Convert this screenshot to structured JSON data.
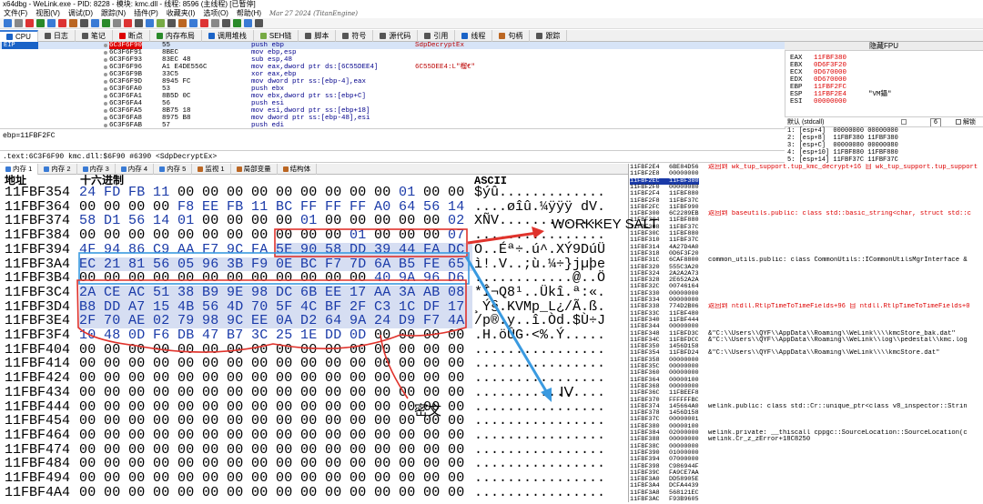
{
  "window_title": "x64dbg - WeLink.exe - PID: 8228 - 模块: kmc.dll - 线程: 8596 (主线程) [已暂停]",
  "menu": [
    "文件(F)",
    "视图(V)",
    "调试(D)",
    "跟踪(N)",
    "插件(P)",
    "收藏夹(I)",
    "选项(O)",
    "帮助(H)"
  ],
  "build_date": "Mar 27 2024 (TitanEngine)",
  "tabs": [
    {
      "label": "CPU",
      "color": "#1a63c7"
    },
    {
      "label": "日志",
      "color": "#555"
    },
    {
      "label": "笔记",
      "color": "#555"
    },
    {
      "label": "断点",
      "color": "#d00"
    },
    {
      "label": "内存布局",
      "color": "#2a8a2a"
    },
    {
      "label": "调用堆栈",
      "color": "#1a63c7"
    },
    {
      "label": "SEH链",
      "color": "#7a4"
    },
    {
      "label": "脚本",
      "color": "#555"
    },
    {
      "label": "符号",
      "color": "#555"
    },
    {
      "label": "源代码",
      "color": "#555"
    },
    {
      "label": "引用",
      "color": "#555"
    },
    {
      "label": "线程",
      "color": "#1a63c7"
    },
    {
      "label": "句柄",
      "color": "#b62"
    },
    {
      "label": "跟踪",
      "color": "#555"
    }
  ],
  "eip_label": "EIP",
  "cpu_rows": [
    {
      "addr": "6C3F6F90",
      "bytes": "55",
      "instr": "push ebp",
      "comment": "SdpDecryptEx"
    },
    {
      "addr": "6C3F6F91",
      "bytes": "8BEC",
      "instr": "mov ebp,esp",
      "comment": ""
    },
    {
      "addr": "6C3F6F93",
      "bytes": "83EC 48",
      "instr": "sub esp,48",
      "comment": ""
    },
    {
      "addr": "6C3F6F96",
      "bytes": "A1 E4DE556C",
      "instr": "mov eax,dword ptr ds:[6C55DEE4]",
      "comment": "6C55DEE4:L\"榴€\""
    },
    {
      "addr": "6C3F6F9B",
      "bytes": "33C5",
      "instr": "xor eax,ebp",
      "comment": ""
    },
    {
      "addr": "6C3F6F9D",
      "bytes": "8945 FC",
      "instr": "mov dword ptr ss:[ebp-4],eax",
      "comment": ""
    },
    {
      "addr": "6C3F6FA0",
      "bytes": "53",
      "instr": "push ebx",
      "comment": ""
    },
    {
      "addr": "6C3F6FA1",
      "bytes": "8B5D 0C",
      "instr": "mov ebx,dword ptr ss:[ebp+C]",
      "comment": ""
    },
    {
      "addr": "6C3F6FA4",
      "bytes": "56",
      "instr": "push esi",
      "comment": ""
    },
    {
      "addr": "6C3F6FA5",
      "bytes": "8B75 18",
      "instr": "mov esi,dword ptr ss:[ebp+18]",
      "comment": ""
    },
    {
      "addr": "6C3F6FA8",
      "bytes": "8975 B8",
      "instr": "mov dword ptr ss:[ebp-48],esi",
      "comment": ""
    },
    {
      "addr": "6C3F6FAB",
      "bytes": "57",
      "instr": "push edi",
      "comment": ""
    }
  ],
  "reg_header": "隐藏FPU",
  "registers": [
    {
      "name": "EAX",
      "value": "11FBF380",
      "note": ""
    },
    {
      "name": "EBX",
      "value": "0D6F3F20",
      "note": ""
    },
    {
      "name": "ECX",
      "value": "0D670000",
      "note": ""
    },
    {
      "name": "EDX",
      "value": "0D670000",
      "note": ""
    },
    {
      "name": "EBP",
      "value": "11FBF2FC",
      "note": ""
    },
    {
      "name": "ESP",
      "value": "11FBF2E4",
      "note": "\"VM鑷\""
    },
    {
      "name": "ESI",
      "value": "00000000",
      "note": ""
    }
  ],
  "callconv": "默认 (stdcall)",
  "callconv_count": "6",
  "unlock_label": "解锁",
  "stack_args": [
    "1: [esp+4]  00000000 00000000",
    "2: [esp+8]  11FBF380 11FBF380",
    "3: [esp+C]  00000080 00000080",
    "4: [esp+10] 11FBF880 11FBF880",
    "5: [esp+14] 11FBF37C 11FBF37C"
  ],
  "info_line": "ebp=11FBF2FC",
  "info_line2": ".text:6C3F6F90 kmc.dll:$6F90 #6390 <SdpDecryptEx>",
  "dump_tabs": [
    "内存 1",
    "内存 2",
    "内存 3",
    "内存 4",
    "内存 5",
    "监视 1",
    "局部变量",
    "结构体"
  ],
  "dump_headers": {
    "addr": "地址",
    "hex": "十六进制",
    "ascii": "ASCII"
  },
  "dump_rows": [
    {
      "addr": "11FBF354",
      "hex": [
        "24",
        "FD",
        "FB",
        "11",
        "00",
        "00",
        "00",
        "00",
        "00",
        "00",
        "00",
        "00",
        "00",
        "01",
        "00",
        "00"
      ],
      "ascii": "$ýû............."
    },
    {
      "addr": "11FBF364",
      "hex": [
        "00",
        "00",
        "00",
        "00",
        "F8",
        "EE",
        "FB",
        "11",
        "BC",
        "FF",
        "FF",
        "FF",
        "A0",
        "64",
        "56",
        "14"
      ],
      "ascii": "....øîû.¼ÿÿÿ dV."
    },
    {
      "addr": "11FBF374",
      "hex": [
        "58",
        "D1",
        "56",
        "14",
        "01",
        "00",
        "00",
        "00",
        "00",
        "01",
        "00",
        "00",
        "00",
        "00",
        "00",
        "02"
      ],
      "ascii": "XÑV............."
    },
    {
      "addr": "11FBF384",
      "hex": [
        "00",
        "00",
        "00",
        "00",
        "00",
        "00",
        "00",
        "00",
        "00",
        "00",
        "00",
        "01",
        "00",
        "00",
        "00",
        "07"
      ],
      "ascii": "................"
    },
    {
      "addr": "11FBF394",
      "hex": [
        "4F",
        "94",
        "86",
        "C9",
        "AA",
        "F7",
        "9C",
        "FA",
        "5E",
        "90",
        "58",
        "DD",
        "39",
        "44",
        "FA",
        "DC"
      ],
      "ascii": "O..Éª÷.ú^.XÝ9DúÜ"
    },
    {
      "addr": "11FBF3A4",
      "hex": [
        "EC",
        "21",
        "81",
        "56",
        "05",
        "96",
        "3B",
        "F9",
        "0E",
        "BC",
        "F7",
        "7D",
        "6A",
        "B5",
        "FE",
        "65"
      ],
      "ascii": "ì!.V..;ù.¼÷}jµþe"
    },
    {
      "addr": "11FBF3B4",
      "hex": [
        "00",
        "00",
        "00",
        "00",
        "00",
        "00",
        "00",
        "00",
        "00",
        "00",
        "00",
        "00",
        "40",
        "9A",
        "96",
        "D6"
      ],
      "ascii": "............@..Ö"
    },
    {
      "addr": "11FBF3C4",
      "hex": [
        "2A",
        "CE",
        "AC",
        "51",
        "38",
        "B9",
        "9E",
        "98",
        "DC",
        "6B",
        "EE",
        "17",
        "AA",
        "3A",
        "AB",
        "08"
      ],
      "ascii": "*Î¬Q8¹..Ükî.ª:«."
    },
    {
      "addr": "11FBF3D4",
      "hex": [
        "B8",
        "DD",
        "A7",
        "15",
        "4B",
        "56",
        "4D",
        "70",
        "5F",
        "4C",
        "BF",
        "2F",
        "C3",
        "1C",
        "DF",
        "17"
      ],
      "ascii": "¸Ý§.KVMp_L¿/Ã.ß."
    },
    {
      "addr": "11FBF3E4",
      "hex": [
        "2F",
        "70",
        "AE",
        "02",
        "79",
        "98",
        "9C",
        "EE",
        "0A",
        "D2",
        "64",
        "9A",
        "24",
        "D9",
        "F7",
        "4A"
      ],
      "ascii": "/p®.y..î.Òd.$Ù÷J"
    },
    {
      "addr": "11FBF3F4",
      "hex": [
        "10",
        "48",
        "0D",
        "F6",
        "DB",
        "47",
        "B7",
        "3C",
        "25",
        "1E",
        "DD",
        "0D",
        "00",
        "00",
        "00",
        "00"
      ],
      "ascii": ".H.öÛG·<%.Ý....."
    },
    {
      "addr": "11FBF404",
      "hex": [
        "00",
        "00",
        "00",
        "00",
        "00",
        "00",
        "00",
        "00",
        "00",
        "00",
        "00",
        "00",
        "00",
        "00",
        "00",
        "00"
      ],
      "ascii": "................"
    },
    {
      "addr": "11FBF414",
      "hex": [
        "00",
        "00",
        "00",
        "00",
        "00",
        "00",
        "00",
        "00",
        "00",
        "00",
        "00",
        "00",
        "00",
        "00",
        "00",
        "00"
      ],
      "ascii": "................"
    },
    {
      "addr": "11FBF424",
      "hex": [
        "00",
        "00",
        "00",
        "00",
        "00",
        "00",
        "00",
        "00",
        "00",
        "00",
        "00",
        "00",
        "00",
        "00",
        "00",
        "00"
      ],
      "ascii": "................"
    },
    {
      "addr": "11FBF434",
      "hex": [
        "00",
        "00",
        "00",
        "00",
        "00",
        "00",
        "00",
        "00",
        "00",
        "00",
        "00",
        "00",
        "00",
        "00",
        "00",
        "00"
      ],
      "ascii": "................"
    },
    {
      "addr": "11FBF444",
      "hex": [
        "00",
        "00",
        "00",
        "00",
        "00",
        "00",
        "00",
        "00",
        "00",
        "00",
        "00",
        "00",
        "00",
        "00",
        "00",
        "00"
      ],
      "ascii": "................"
    },
    {
      "addr": "11FBF454",
      "hex": [
        "00",
        "00",
        "00",
        "00",
        "00",
        "00",
        "00",
        "00",
        "00",
        "00",
        "00",
        "00",
        "00",
        "00",
        "00",
        "00"
      ],
      "ascii": "................"
    },
    {
      "addr": "11FBF464",
      "hex": [
        "00",
        "00",
        "00",
        "00",
        "00",
        "00",
        "00",
        "00",
        "00",
        "00",
        "00",
        "00",
        "00",
        "00",
        "00",
        "00"
      ],
      "ascii": "................"
    },
    {
      "addr": "11FBF474",
      "hex": [
        "00",
        "00",
        "00",
        "00",
        "00",
        "00",
        "00",
        "00",
        "00",
        "00",
        "00",
        "00",
        "00",
        "00",
        "00",
        "00"
      ],
      "ascii": "................"
    },
    {
      "addr": "11FBF484",
      "hex": [
        "00",
        "00",
        "00",
        "00",
        "00",
        "00",
        "00",
        "00",
        "00",
        "00",
        "00",
        "00",
        "00",
        "00",
        "00",
        "00"
      ],
      "ascii": "................"
    },
    {
      "addr": "11FBF494",
      "hex": [
        "00",
        "00",
        "00",
        "00",
        "00",
        "00",
        "00",
        "00",
        "00",
        "00",
        "00",
        "00",
        "00",
        "00",
        "00",
        "00"
      ],
      "ascii": "................"
    },
    {
      "addr": "11FBF4A4",
      "hex": [
        "00",
        "00",
        "00",
        "00",
        "00",
        "00",
        "00",
        "00",
        "00",
        "00",
        "00",
        "00",
        "00",
        "00",
        "00",
        "00"
      ],
      "ascii": "................"
    }
  ],
  "stack_rows": [
    {
      "addr": "11FBF2E4",
      "val": "6BE84D56"
    },
    {
      "addr": "11FBF2E8",
      "val": "00000000"
    },
    {
      "addr": "11FBF2EC",
      "val": "11FBF380"
    },
    {
      "addr": "11FBF2F0",
      "val": "00000080"
    },
    {
      "addr": "11FBF2F4",
      "val": "11FBF880"
    },
    {
      "addr": "11FBF2F8",
      "val": "11FBF37C"
    },
    {
      "addr": "11FBF2FC",
      "val": "11FBF990"
    },
    {
      "addr": "11FBF300",
      "val": "6C2289EB"
    },
    {
      "addr": "11FBF304",
      "val": "11FBF880"
    },
    {
      "addr": "11FBF308",
      "val": "11FBF37C"
    },
    {
      "addr": "11FBF30C",
      "val": "11FBF880"
    },
    {
      "addr": "11FBF310",
      "val": "11FBF37C"
    },
    {
      "addr": "11FBF314",
      "val": "4A27D4A0"
    },
    {
      "addr": "11FBF318",
      "val": "0D6F3F20"
    },
    {
      "addr": "11FBF31C",
      "val": "6CAF8800"
    },
    {
      "addr": "11FBF320",
      "val": "555C3A20"
    },
    {
      "addr": "11FBF324",
      "val": "2A2A2A73"
    },
    {
      "addr": "11FBF328",
      "val": "2E652A2A"
    },
    {
      "addr": "11FBF32C",
      "val": "00746164"
    },
    {
      "addr": "11FBF330",
      "val": "00000000"
    },
    {
      "addr": "11FBF334",
      "val": "00000000"
    },
    {
      "addr": "11FBF338",
      "val": "774D2B06"
    },
    {
      "addr": "11FBF33C",
      "val": "11FBF480"
    },
    {
      "addr": "11FBF340",
      "val": "11FBF444"
    },
    {
      "addr": "11FBF344",
      "val": "00000000"
    },
    {
      "addr": "11FBF348",
      "val": "11FBFD3C"
    },
    {
      "addr": "11FBF34C",
      "val": "11FBFDCC"
    },
    {
      "addr": "11FBF350",
      "val": "1456D158"
    },
    {
      "addr": "11FBF354",
      "val": "11FBFD24"
    },
    {
      "addr": "11FBF358",
      "val": "00000000"
    },
    {
      "addr": "11FBF35C",
      "val": "00000000"
    },
    {
      "addr": "11FBF360",
      "val": "00000000"
    },
    {
      "addr": "11FBF364",
      "val": "00000100"
    },
    {
      "addr": "11FBF368",
      "val": "00000000"
    },
    {
      "addr": "11FBF36C",
      "val": "11FBEEF8"
    },
    {
      "addr": "11FBF370",
      "val": "FFFFFFBC"
    },
    {
      "addr": "11FBF374",
      "val": "145664A0"
    },
    {
      "addr": "11FBF378",
      "val": "1456D158"
    },
    {
      "addr": "11FBF37C",
      "val": "00000001"
    },
    {
      "addr": "11FBF380",
      "val": "00000100"
    },
    {
      "addr": "11FBF384",
      "val": "02000000"
    },
    {
      "addr": "11FBF388",
      "val": "00000000"
    },
    {
      "addr": "11FBF38C",
      "val": "00000000"
    },
    {
      "addr": "11FBF390",
      "val": "01000000"
    },
    {
      "addr": "11FBF394",
      "val": "07000000"
    },
    {
      "addr": "11FBF398",
      "val": "C986944F"
    },
    {
      "addr": "11FBF39C",
      "val": "FA9CE7AA"
    },
    {
      "addr": "11FBF3A0",
      "val": "DD58905E"
    },
    {
      "addr": "11FBF3A4",
      "val": "DCFA4439"
    },
    {
      "addr": "11FBF3A8",
      "val": "568121EC"
    },
    {
      "addr": "11FBF3AC",
      "val": "F93B9605"
    }
  ],
  "stack_comments": [
    {
      "row": 0,
      "text": "返回到 wk_tup_support.tup_kmc_decrypt+16 自 wk_tup_support.tup_support",
      "color": "#d00"
    },
    {
      "row": 7,
      "text": "返回到 baseutils.public: class std::basic_string<char, struct std::c",
      "color": "#d00"
    },
    {
      "row": 14,
      "text": "common_utils.public: class CommonUtils::ICommonUtilsMgrInterface &",
      "color": "#000"
    },
    {
      "row": 21,
      "text": "返回到 ntdll.RtlpTimeToTimeFields+96 自 ntdll.RtlpTimeToTimeFields+0",
      "color": "#d00"
    },
    {
      "row": 25,
      "text": "&\"C:\\\\Users\\\\QYF\\\\AppData\\\\Roaming\\\\WeLink\\\\\\\\kmcStore_bak.dat\"",
      "color": "#000"
    },
    {
      "row": 26,
      "text": "&\"C:\\\\Users\\\\QYF\\\\AppData\\\\Roaming\\\\WeLink\\\\log\\\\pedestal\\\\kmc.log",
      "color": "#000"
    },
    {
      "row": 28,
      "text": "&\"C:\\\\Users\\\\QYF\\\\AppData\\\\Roaming\\\\WeLink\\\\\\\\kmcStore.dat\"",
      "color": "#000"
    },
    {
      "row": 36,
      "text": "welink.public: class std::Cr::unique_ptr<class v8_inspector::Strin",
      "color": "#000"
    },
    {
      "row": 40,
      "text": "welink.private: __thiscall cppgc::SourceLocation::SourceLocation(c",
      "color": "#000"
    },
    {
      "row": 41,
      "text": "welink.Cr_z_zError+18C8250",
      "color": "#000"
    }
  ],
  "annotations": {
    "workkey_label": "WORKKEY SALT",
    "iv_label": "IV",
    "cipher_label": "密文",
    "red": "#e0332c",
    "blue": "#3a9ae0"
  }
}
